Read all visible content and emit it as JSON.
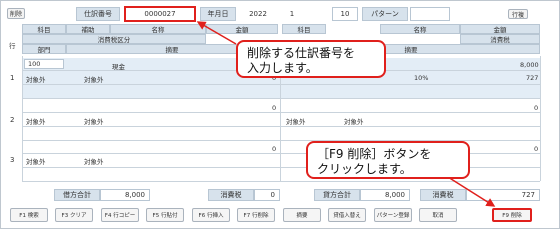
{
  "header": {
    "delete_small": "削除",
    "slip_no_label": "仕訳番号",
    "slip_no_value": "0000027",
    "date_label": "年月日",
    "year": "2022",
    "month": "1",
    "day": "10",
    "pattern_label": "パターン",
    "line_btn": "行複"
  },
  "columns": {
    "row": "行",
    "kamoku": "科目",
    "hojo": "補助",
    "meisho": "名称",
    "kingaku": "金額",
    "shohizei_kubun": "消費税区分",
    "shohizei": "消費税",
    "bumon": "部門",
    "tekiyo": "摘要"
  },
  "rows": [
    {
      "num": "1",
      "debit_code": "100",
      "debit_name": "現金",
      "debit_tax1": "対象外",
      "debit_tax2": "対象外",
      "credit_amount": "8,000",
      "credit_tax_rate": "10%",
      "credit_tax": "727",
      "debit_amount": "0"
    },
    {
      "num": "2",
      "debit_tax1": "対象外",
      "debit_tax2": "対象外",
      "credit_tax1": "対象外",
      "credit_tax2": "対象外",
      "debit_amount": "0",
      "credit_amount": "0"
    },
    {
      "num": "3",
      "debit_tax1": "対象外",
      "debit_tax2": "対象外",
      "debit_amount": "0",
      "credit_amount": "0"
    }
  ],
  "totals": {
    "debit_total_label": "借方合計",
    "debit_total": "8,000",
    "tax_label": "消費税",
    "debit_tax": "0",
    "credit_total_label": "貸方合計",
    "credit_total": "8,000",
    "credit_tax_label": "消費税",
    "credit_tax": "727"
  },
  "footer": [
    "F1 検索",
    "F3 クリア",
    "F4 行コピー",
    "F5 行貼付",
    "F6 行挿入",
    "F7 行削除",
    "摘要",
    "貸借入替え",
    "パターン登録",
    "取消",
    "F9 削除"
  ],
  "callouts": {
    "top": "削除する仕訳番号を\n入力します。",
    "bottom": "［F9 削除］ボタンを\nクリックします。"
  },
  "colors": {
    "callout_border": "#e0201c",
    "header_bg": "#d7e2ec"
  }
}
